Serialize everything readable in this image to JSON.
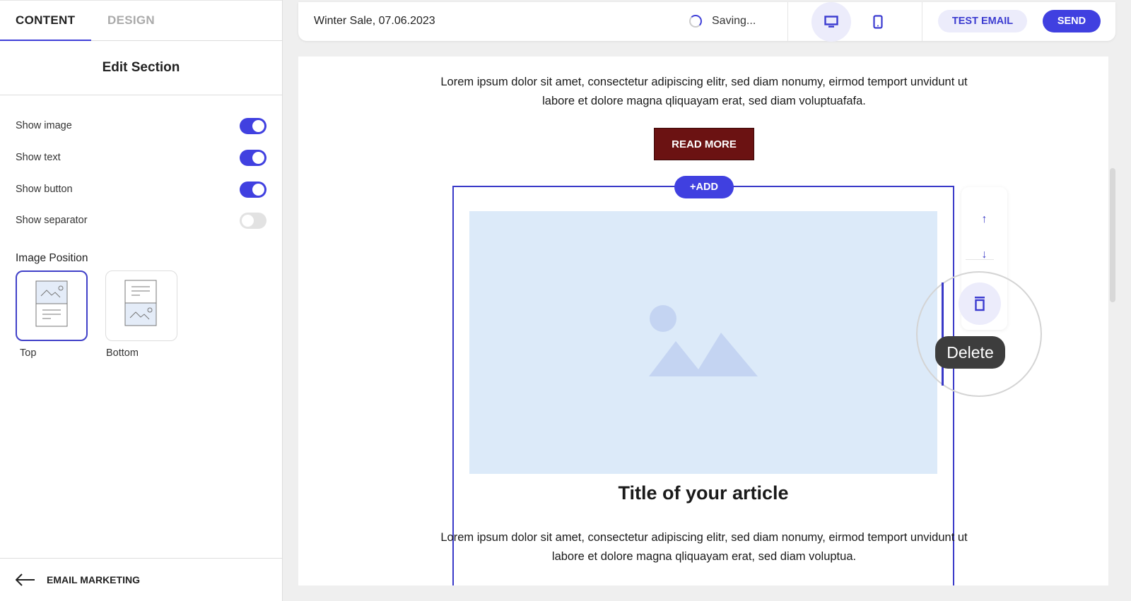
{
  "sidebar": {
    "tabs": [
      {
        "label": "CONTENT",
        "active": true
      },
      {
        "label": "DESIGN",
        "active": false
      }
    ],
    "section_title": "Edit Section",
    "toggles": [
      {
        "label": "Show image",
        "on": true
      },
      {
        "label": "Show text",
        "on": true
      },
      {
        "label": "Show button",
        "on": true
      },
      {
        "label": "Show separator",
        "on": false
      }
    ],
    "image_position": {
      "label": "Image Position",
      "options": [
        {
          "label": "Top",
          "selected": true
        },
        {
          "label": "Bottom",
          "selected": false
        }
      ]
    },
    "back_label": "EMAIL MARKETING"
  },
  "topbar": {
    "campaign_name": "Winter Sale, 07.06.2023",
    "status": "Saving...",
    "devices": [
      {
        "name": "desktop",
        "active": true
      },
      {
        "name": "mobile",
        "active": false
      }
    ],
    "test_email_label": "TEST EMAIL",
    "send_label": "SEND"
  },
  "canvas": {
    "intro_text": "Lorem ipsum dolor sit amet, consectetur adipiscing elitr, sed diam nonumy, eirmod temport unvidunt ut labore et dolore magna qliquayam erat, sed diam voluptuafafa.",
    "read_more_label": "READ MORE",
    "add_label": "+ADD",
    "article": {
      "title": "Title of your article",
      "text": "Lorem ipsum dolor sit amet, consectetur adipiscing elitr, sed diam nonumy, eirmod temport unvidunt ut labore et dolore magna qliquayam erat, sed diam voluptua."
    },
    "tooltip": "Delete"
  },
  "colors": {
    "accent": "#4040e0",
    "button_bg": "#6b1212",
    "image_placeholder": "#dceaf9"
  }
}
